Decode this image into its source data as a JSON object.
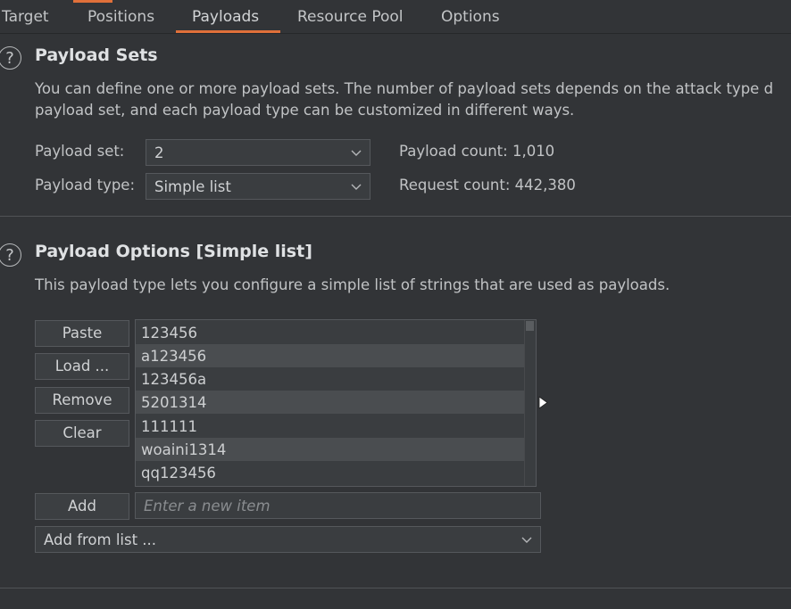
{
  "tabs": [
    {
      "label": "Target"
    },
    {
      "label": "Positions"
    },
    {
      "label": "Payloads"
    },
    {
      "label": "Resource Pool"
    },
    {
      "label": "Options"
    }
  ],
  "payload_sets": {
    "title": "Payload Sets",
    "description_line1": "You can define one or more payload sets. The number of payload sets depends on the attack type d",
    "description_line2": "payload set, and each payload type can be customized in different ways.",
    "set_label": "Payload set:",
    "set_value": "2",
    "type_label": "Payload type:",
    "type_value": "Simple list",
    "payload_count": "Payload count: 1,010",
    "request_count": "Request count: 442,380"
  },
  "payload_options": {
    "title": "Payload Options [Simple list]",
    "description": "This payload type lets you configure a simple list of strings that are used as payloads.",
    "buttons": {
      "paste": "Paste",
      "load": "Load ...",
      "remove": "Remove",
      "clear": "Clear",
      "add": "Add"
    },
    "items": [
      "123456",
      "a123456",
      "123456a",
      "5201314",
      "111111",
      "woaini1314",
      "qq123456"
    ],
    "new_item_placeholder": "Enter a new item",
    "add_from_list": "Add from list ..."
  },
  "icons": {
    "help": "help-circle-icon",
    "chevron": "chevron-down-icon",
    "cursor": "mouse-pointer-icon"
  },
  "colors": {
    "background": "#323437",
    "accent": "#e0703a"
  }
}
